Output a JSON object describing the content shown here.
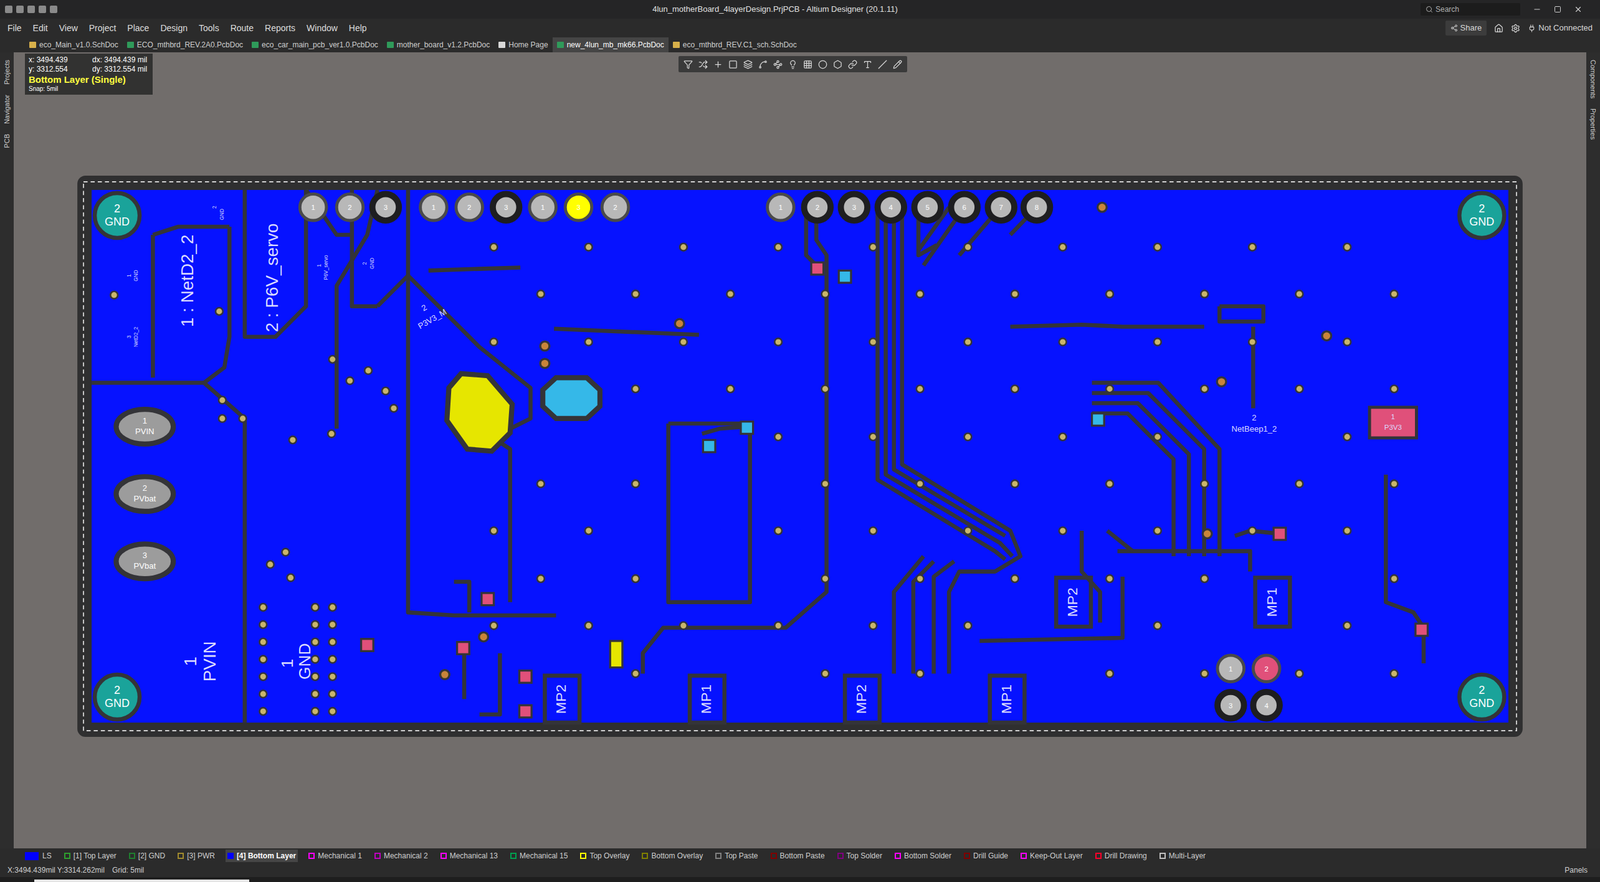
{
  "window": {
    "title": "4lun_motherBoard_4layerDesign.PrjPCB - Altium Designer (20.1.11)",
    "search": "Search"
  },
  "menu": [
    "File",
    "Edit",
    "View",
    "Project",
    "Place",
    "Design",
    "Tools",
    "Route",
    "Reports",
    "Window",
    "Help"
  ],
  "menu_right": {
    "share": "Share",
    "connection": "Not Connected"
  },
  "doc_tabs": [
    {
      "label": "eco_Main_v1.0.SchDoc",
      "kind": "sch",
      "selected": false
    },
    {
      "label": "ECO_mthbrd_REV.2A0.PcbDoc",
      "kind": "pcb",
      "selected": false
    },
    {
      "label": "eco_car_main_pcb_ver1.0.PcbDoc",
      "kind": "pcb",
      "selected": false
    },
    {
      "label": "mother_board_v1.2.PcbDoc",
      "kind": "pcb",
      "selected": false
    },
    {
      "label": "Home Page",
      "kind": "home",
      "selected": false
    },
    {
      "label": "new_4lun_mb_mk66.PcbDoc",
      "kind": "pcb",
      "selected": true
    },
    {
      "label": "eco_mthbrd_REV.C1_sch.SchDoc",
      "kind": "sch",
      "selected": false
    }
  ],
  "left_panels": [
    "Projects",
    "Navigator",
    "PCB"
  ],
  "right_panels": [
    "Components",
    "Properties"
  ],
  "hud": {
    "x": "x: 3494.439",
    "dx": "dx: 3494.439 mil",
    "y": "y: 3312.554",
    "dy": "dy: 3312.554 mil",
    "layer": "Bottom Layer (Single)",
    "snap": "Snap: 5mil"
  },
  "board": {
    "mounting_holes": [
      {
        "number": "2",
        "net": "GND"
      },
      {
        "number": "2",
        "net": "GND"
      },
      {
        "number": "2",
        "net": "GND"
      },
      {
        "number": "2",
        "net": "GND"
      }
    ],
    "power_pads": [
      {
        "number": "1",
        "net": "PVIN"
      },
      {
        "number": "2",
        "net": "PVbat"
      },
      {
        "number": "3",
        "net": "PVbat"
      }
    ],
    "header_pins": [
      {
        "number": "1",
        "kind": "plain"
      },
      {
        "number": "2",
        "kind": "plain"
      },
      {
        "number": "3",
        "kind": "dark"
      },
      {
        "number": "1",
        "kind": "plain"
      },
      {
        "number": "2",
        "kind": "plain"
      },
      {
        "number": "3",
        "kind": "dark"
      },
      {
        "number": "1",
        "kind": "plain"
      },
      {
        "number": "3",
        "kind": "highlight"
      },
      {
        "number": "2",
        "kind": "plain"
      },
      {
        "number": "1",
        "kind": "plain"
      },
      {
        "number": "2",
        "kind": "dark"
      },
      {
        "number": "3",
        "kind": "dark"
      },
      {
        "number": "4",
        "kind": "dark"
      },
      {
        "number": "5",
        "kind": "dark"
      },
      {
        "number": "6",
        "kind": "dark"
      },
      {
        "number": "7",
        "kind": "dark"
      },
      {
        "number": "8",
        "kind": "dark"
      },
      {
        "number": "1",
        "kind": "plain"
      },
      {
        "number": "2",
        "kind": "pink"
      },
      {
        "number": "3",
        "kind": "dark"
      },
      {
        "number": "4",
        "kind": "dark"
      }
    ],
    "labels": [
      {
        "text": "1 : NetD2_2"
      },
      {
        "text": "2 : P6V_servo"
      },
      {
        "text": "1"
      },
      {
        "text": "PVIN"
      },
      {
        "text": "1"
      },
      {
        "text": "GND"
      },
      {
        "text": "2"
      },
      {
        "text": "P3V3_M"
      },
      {
        "text": "MP2"
      },
      {
        "text": "MP1"
      },
      {
        "text": "MP2"
      },
      {
        "text": "MP1"
      },
      {
        "text": "MP2"
      },
      {
        "text": "MP1"
      },
      {
        "text": "2"
      },
      {
        "text": "NetBeep1_2"
      },
      {
        "text": "1"
      },
      {
        "text": "P3V3"
      },
      {
        "text": "2"
      },
      {
        "text": "GND"
      },
      {
        "text": "1"
      },
      {
        "text": "GND"
      },
      {
        "text": "3"
      },
      {
        "text": "NetD2_2"
      },
      {
        "text": "1"
      },
      {
        "text": "P6V_servo"
      },
      {
        "text": "2"
      },
      {
        "text": "GND"
      }
    ]
  },
  "layers": [
    {
      "label": "LS",
      "color": "#0000ff",
      "kind": "set",
      "selected": false
    },
    {
      "label": "[1] Top Layer",
      "color": "#2ea02e",
      "kind": "layer",
      "selected": false
    },
    {
      "label": "[2] GND",
      "color": "#1f7f2f",
      "kind": "layer",
      "selected": false
    },
    {
      "label": "[3] PWR",
      "color": "#a08a2e",
      "kind": "layer",
      "selected": false
    },
    {
      "label": "[4] Bottom Layer",
      "color": "#0000ff",
      "kind": "layer",
      "selected": true
    },
    {
      "label": "Mechanical 1",
      "color": "#ff00ff",
      "kind": "layer",
      "selected": false
    },
    {
      "label": "Mechanical 2",
      "color": "#c000c0",
      "kind": "layer",
      "selected": false
    },
    {
      "label": "Mechanical 13",
      "color": "#ff00ff",
      "kind": "layer",
      "selected": false
    },
    {
      "label": "Mechanical 15",
      "color": "#00a050",
      "kind": "layer",
      "selected": false
    },
    {
      "label": "Top Overlay",
      "color": "#ffff00",
      "kind": "layer",
      "selected": false
    },
    {
      "label": "Bottom Overlay",
      "color": "#808000",
      "kind": "layer",
      "selected": false
    },
    {
      "label": "Top Paste",
      "color": "#808080",
      "kind": "layer",
      "selected": false
    },
    {
      "label": "Bottom Paste",
      "color": "#800000",
      "kind": "layer",
      "selected": false
    },
    {
      "label": "Top Solder",
      "color": "#800080",
      "kind": "layer",
      "selected": false
    },
    {
      "label": "Bottom Solder",
      "color": "#ff00ff",
      "kind": "layer",
      "selected": false
    },
    {
      "label": "Drill Guide",
      "color": "#800000",
      "kind": "layer",
      "selected": false
    },
    {
      "label": "Keep-Out Layer",
      "color": "#ff00ff",
      "kind": "layer",
      "selected": false
    },
    {
      "label": "Drill Drawing",
      "color": "#ff002a",
      "kind": "layer",
      "selected": false
    },
    {
      "label": "Multi-Layer",
      "color": "#c0c0c0",
      "kind": "layer",
      "selected": false
    }
  ],
  "status_bar": {
    "coords": "X:3494.439mil Y:3314.262mil",
    "grid": "Grid: 5mil",
    "panels": "Panels"
  }
}
